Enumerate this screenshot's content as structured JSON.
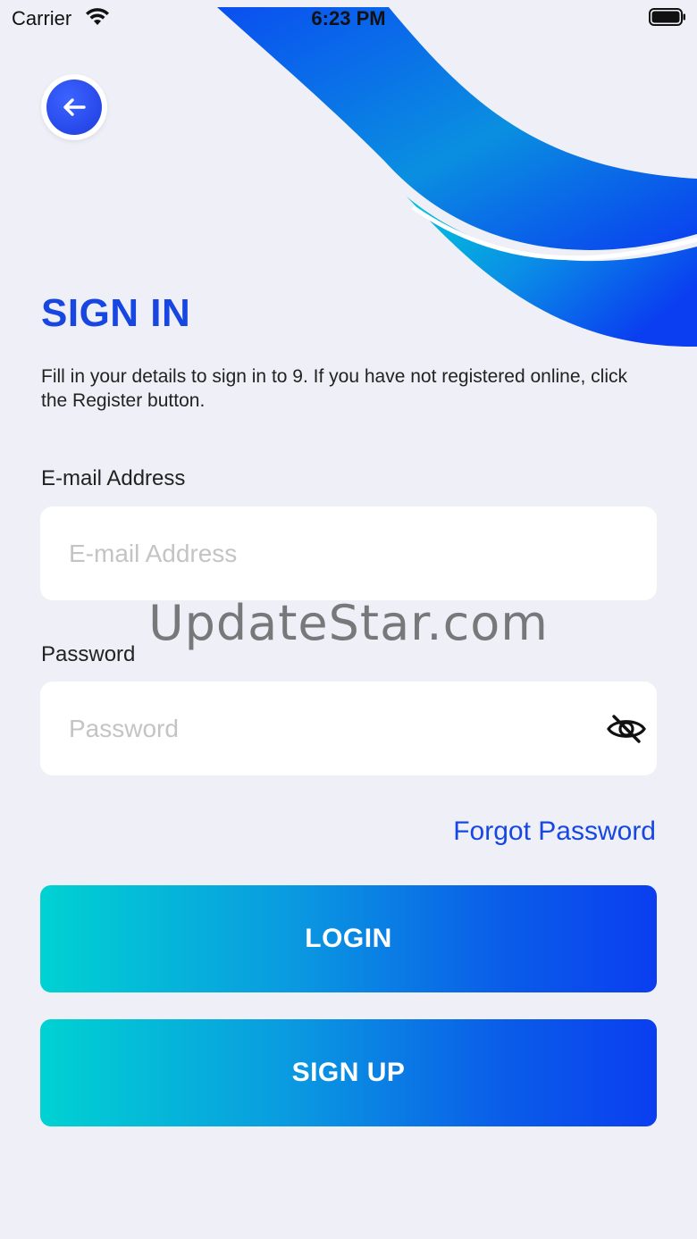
{
  "status_bar": {
    "carrier": "Carrier",
    "time": "6:23 PM"
  },
  "header": {
    "title": "SIGN IN",
    "subtitle": "Fill in your details to sign in to 9. If you have not registered online, click the Register button."
  },
  "form": {
    "email_label": "E-mail Address",
    "email_placeholder": "E-mail Address",
    "password_label": "Password",
    "password_placeholder": "Password",
    "forgot_password": "Forgot Password"
  },
  "buttons": {
    "login": "LOGIN",
    "signup": "SIGN UP"
  },
  "watermark": "UpdateStar.com",
  "icons": {
    "back": "arrow-left-icon",
    "visibility": "eye-off-icon",
    "wifi": "wifi-icon",
    "battery": "battery-icon"
  },
  "colors": {
    "accent": "#1747e0",
    "gradient_start": "#00d2d2",
    "gradient_end": "#0a3ef0",
    "background": "#eff0f7"
  }
}
